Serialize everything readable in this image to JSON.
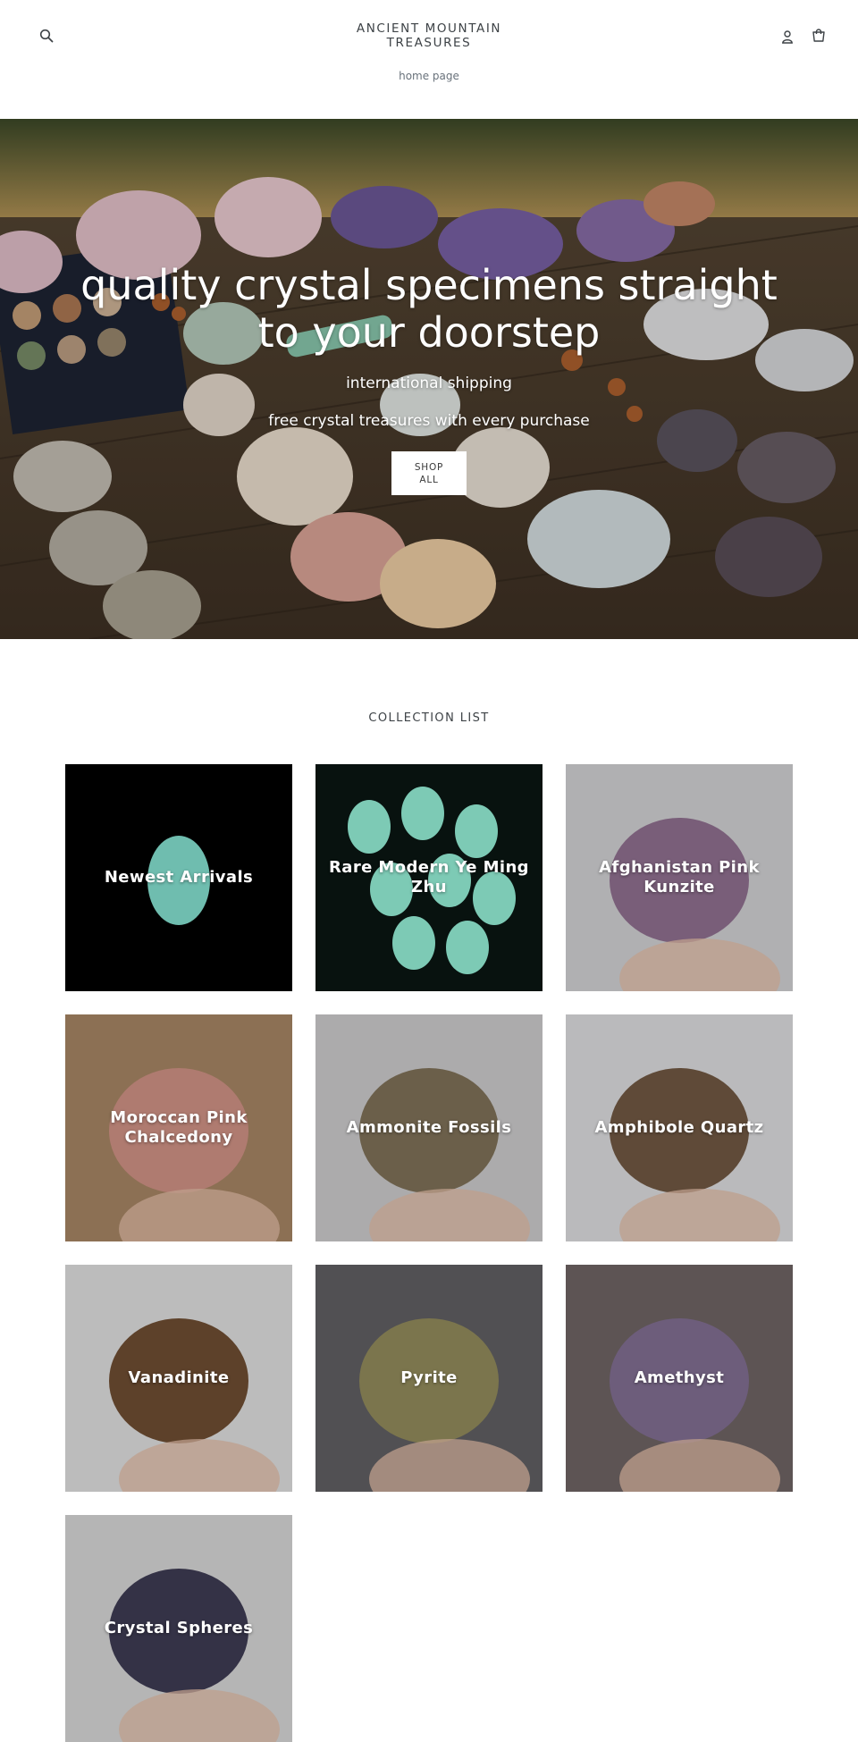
{
  "header": {
    "logo_line1": "ANCIENT MOUNTAIN",
    "logo_line2": "TREASURES",
    "nav": [
      "home page"
    ],
    "icons": [
      "search-icon",
      "account-icon",
      "cart-icon"
    ]
  },
  "hero": {
    "title_line1": "quality crystal specimens straight",
    "title_line2": "to your doorstep",
    "subtitle1": "international shipping",
    "subtitle2": "free crystal treasures with every purchase",
    "button_line1": "SHOP",
    "button_line2": "ALL"
  },
  "collection": {
    "title": "COLLECTION LIST",
    "items": [
      {
        "label": "Newest Arrivals",
        "colors": [
          "#000000",
          "#7fd8c8"
        ]
      },
      {
        "label": "Rare Modern Ye Ming Zhu",
        "colors": [
          "#0a1512",
          "#8fe6cf"
        ]
      },
      {
        "label": "Afghanistan Pink Kunzite",
        "colors": [
          "#c9c9cb",
          "#8a6b8a"
        ]
      },
      {
        "label": "Moroccan Pink Chalcedony",
        "colors": [
          "#a08060",
          "#c88c80"
        ]
      },
      {
        "label": "Ammonite Fossils",
        "colors": [
          "#c4c3c4",
          "#7a6d55"
        ]
      },
      {
        "label": "Amphibole Quartz",
        "colors": [
          "#d4d4d6",
          "#6d5540"
        ]
      },
      {
        "label": "Vanadinite",
        "colors": [
          "#d6d6d6",
          "#6a4a30"
        ]
      },
      {
        "label": "Pyrite",
        "colors": [
          "#5d5c5f",
          "#8c8658"
        ]
      },
      {
        "label": "Amethyst",
        "colors": [
          "#6a6060",
          "#7d6a8c"
        ]
      },
      {
        "label": "Crystal Spheres",
        "colors": [
          "#cfcfcf",
          "#3c3950"
        ]
      }
    ]
  }
}
